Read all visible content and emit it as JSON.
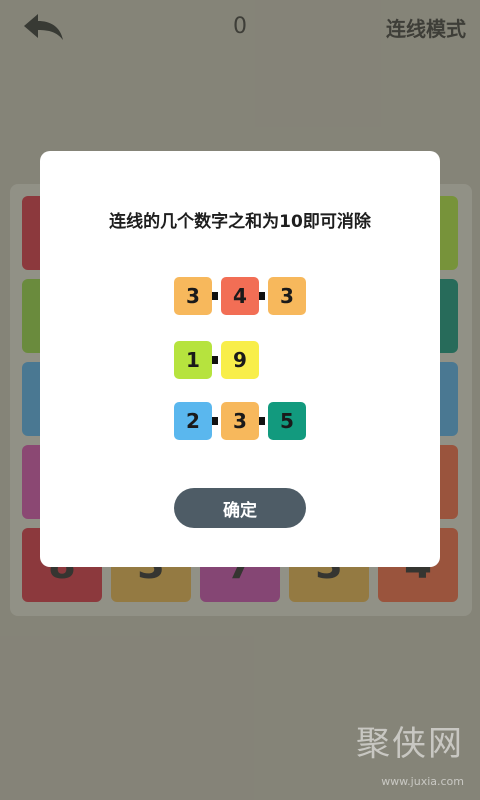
{
  "header": {
    "back_icon": "back-arrow-icon",
    "score": "0",
    "mode_label": "连线模式"
  },
  "board": {
    "colors": {
      "red": "#c0313f",
      "lime": "#9ccb3a",
      "green": "#86be3f",
      "teal": "#128771",
      "blue": "#4e9ed1",
      "magenta": "#be4b9b",
      "orange": "#d8603e",
      "gold": "#cda148",
      "purple": "#b3479e"
    },
    "bottom_row": [
      {
        "value": "8",
        "color": "#c0313f"
      },
      {
        "value": "3",
        "color": "#cda148"
      },
      {
        "value": "7",
        "color": "#b3479e"
      },
      {
        "value": "3",
        "color": "#cda148"
      },
      {
        "value": "4",
        "color": "#d8603e"
      }
    ]
  },
  "dialog": {
    "title": "连线的几个数字之和为10即可消除",
    "examples": [
      [
        {
          "value": "3",
          "color": "#f7b85c"
        },
        {
          "value": "4",
          "color": "#f26e55"
        },
        {
          "value": "3",
          "color": "#f7b85c"
        }
      ],
      [
        {
          "value": "1",
          "color": "#b6e33e"
        },
        {
          "value": "9",
          "color": "#f8ee4a"
        }
      ],
      [
        {
          "value": "2",
          "color": "#5ab7ee"
        },
        {
          "value": "3",
          "color": "#f7b85c"
        },
        {
          "value": "5",
          "color": "#129a7e"
        }
      ]
    ],
    "confirm_label": "确定",
    "confirm_color": "#4e5c66"
  },
  "watermark": {
    "text": "聚侠网",
    "url": "www.juxia.com"
  }
}
